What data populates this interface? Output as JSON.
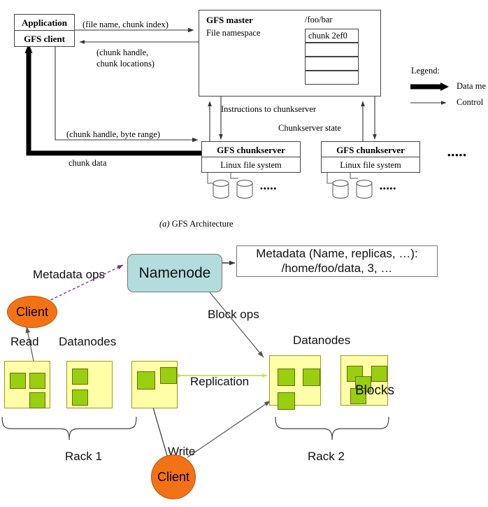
{
  "figure_a": {
    "caption_prefix": "(a)",
    "caption_text": "GFS Architecture",
    "client_stack": {
      "application": "Application",
      "gfs_client": "GFS client"
    },
    "master": {
      "title": "GFS master",
      "subtitle": "File namespace",
      "file_path": "/foo/bar",
      "chunk_rows": [
        "chunk 2ef0",
        "",
        "",
        ""
      ]
    },
    "edges": {
      "request": "(file name, chunk index)",
      "reply_line1": "(chunk handle,",
      "reply_line2": "chunk locations)",
      "data_request": "(chunk handle, byte range)",
      "data_flow": "chunk data",
      "instructions": "Instructions to chunkserver",
      "state": "Chunkserver state"
    },
    "chunkservers": [
      {
        "title": "GFS chunkserver",
        "fs": "Linux file system"
      },
      {
        "title": "GFS chunkserver",
        "fs": "Linux file system"
      }
    ],
    "ellipsis": "•••••",
    "legend": {
      "title": "Legend:",
      "data_label": "Data me",
      "control_label": "Control"
    }
  },
  "figure_b": {
    "namenode": "Namenode",
    "metadata_line1": "Metadata (Name, replicas, …):",
    "metadata_line2": "/home/foo/data, 3, …",
    "metadata_ops": "Metadata ops",
    "block_ops": "Block ops",
    "replication": "Replication",
    "read": "Read",
    "write": "Write",
    "blocks_label": "Blocks",
    "client_read": "Client",
    "client_write": "Client",
    "racks": [
      {
        "label": "Rack 1",
        "datanodes_label": "Datanodes"
      },
      {
        "label": "Rack 2",
        "datanodes_label": "Datanodes"
      }
    ]
  },
  "colors": {
    "namenode_fill": "#b3dcdc",
    "client_fill": "#f47216",
    "datanode_fill": "#ffffa8",
    "block_fill": "#9ace10",
    "metadata_arrow": "#7d2b8b",
    "replication_arrow": "#c8e84c"
  }
}
